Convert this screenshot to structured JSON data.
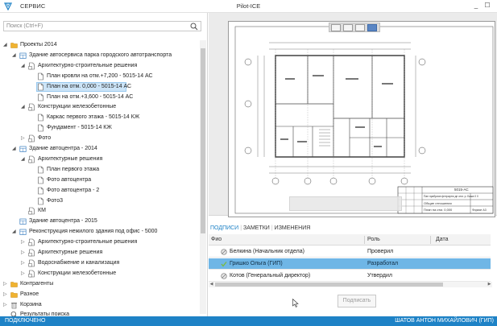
{
  "app": {
    "menu_label": "СЕРВИС",
    "window_title": "Pilot-ICE",
    "controls": {
      "minimize": "_",
      "maximize": "☐"
    }
  },
  "search": {
    "placeholder": "Поиск (Ctrl+F)",
    "value": ""
  },
  "tree": [
    {
      "label": "Проекты 2014",
      "icon": "folder-icon",
      "expanded": true
    },
    {
      "label": "Здание автосервиса парка городского автотранспорта",
      "icon": "building-icon",
      "expanded": true
    },
    {
      "label": "Архитектурно-строительные решения",
      "icon": "document-folder-icon",
      "expanded": true
    },
    {
      "label": "План кровли на отм.+7,200 - 5015-14 АС",
      "icon": "document-icon"
    },
    {
      "label": "План на отм. 0,000 - 5015-14 АС",
      "icon": "document-icon",
      "selected": true
    },
    {
      "label": "План на отм.+3,600 - 5015-14 АС",
      "icon": "document-icon"
    },
    {
      "label": "Конструкции железобетонные",
      "icon": "document-folder-icon",
      "expanded": true
    },
    {
      "label": "Каркас первого этажа - 5015-14 КЖ",
      "icon": "document-icon"
    },
    {
      "label": "Фундамент - 5015-14 КЖ",
      "icon": "document-icon"
    },
    {
      "label": "Фото",
      "icon": "document-folder-icon",
      "expanded": false
    },
    {
      "label": "Здание автоцентра - 2014",
      "icon": "building-icon",
      "expanded": true
    },
    {
      "label": "Архитектурные решения",
      "icon": "document-folder-icon",
      "expanded": true
    },
    {
      "label": "План первого этажа",
      "icon": "document-icon"
    },
    {
      "label": "Фото автоцентра",
      "icon": "document-icon"
    },
    {
      "label": "Фото автоцентра - 2",
      "icon": "document-icon"
    },
    {
      "label": "Фото3",
      "icon": "document-icon"
    },
    {
      "label": "КМ",
      "icon": "document-folder-icon"
    },
    {
      "label": "Здание автоцентра - 2015",
      "icon": "building-icon"
    },
    {
      "label": "Реконструкция нежилого здания под офис - 5000",
      "icon": "building-icon",
      "expanded": true
    },
    {
      "label": "Архитектурно-строительные решения",
      "icon": "document-folder-icon",
      "expanded": false
    },
    {
      "label": "Архитектурные решения",
      "icon": "document-folder-icon",
      "expanded": false
    },
    {
      "label": "Водоснабжение и канализация",
      "icon": "document-folder-icon",
      "expanded": false
    },
    {
      "label": "Конструкции железобетонные",
      "icon": "document-folder-icon",
      "expanded": false
    },
    {
      "label": "Контрагенты",
      "icon": "folder-icon",
      "expanded": false
    },
    {
      "label": "Разное",
      "icon": "folder-icon",
      "expanded": false
    },
    {
      "label": "Корзина",
      "icon": "trash-icon",
      "expanded": false
    },
    {
      "label": "Результаты поиска",
      "icon": "search-icon"
    }
  ],
  "tabs": [
    {
      "label": "ПОДПИСИ",
      "active": true
    },
    {
      "label": "ЗАМЕТКИ",
      "active": false
    },
    {
      "label": "ИЗМЕНЕНИЯ",
      "active": false
    }
  ],
  "signatures": {
    "columns": [
      "Фио",
      "Роль",
      "Дата"
    ],
    "rows": [
      {
        "name": "Белкина (Начальник отдела)",
        "role": "Проверил",
        "date": "",
        "icon": "pending-icon"
      },
      {
        "name": "Гришко Ольга (ГИП)",
        "role": "Разработал",
        "date": "",
        "icon": "signed-check-icon",
        "selected": true
      },
      {
        "name": "Котов (Генеральный директор)",
        "role": "Утвердил",
        "date": "",
        "icon": "pending-icon"
      }
    ]
  },
  "sign_button": "Подписать",
  "drawing": {
    "stamp_code": "5015-АС",
    "stamp_line1": "Пан прабриан фтерартм дп отм. р. Бажа 0 0",
    "stamp_line2": "Общие отношения",
    "stamp_line3": "План на отм. 0,000",
    "stamp_sheet": "Формат A3"
  },
  "status": {
    "left": "ПОДКЛЮЧЕНО",
    "right": "ШАТОВ АНТОН МИХАЙЛОВИЧ (ГИП)"
  },
  "colors": {
    "accent": "#1e82c6",
    "selection": "#cce4f7",
    "row_selected": "#6fb6e6",
    "folder": "#f0b330"
  }
}
